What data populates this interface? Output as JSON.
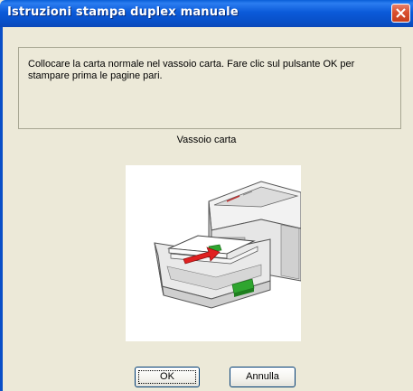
{
  "window": {
    "title": "Istruzioni stampa duplex manuale"
  },
  "message": {
    "text": "Collocare la carta normale nel vassoio carta.  Fare clic sul pulsante OK per stampare prima le pagine pari."
  },
  "tray": {
    "label": "Vassoio carta"
  },
  "buttons": {
    "ok_label": "OK",
    "cancel_label": "Annulla"
  },
  "icons": {
    "close": "close-icon",
    "illustration": "printer-tray-illustration"
  },
  "colors": {
    "titlebar": "#0b5ad9",
    "close_button": "#d9502f",
    "dialog_background": "#ece9d8",
    "arrow": "#e02020",
    "guide": "#2fa52f"
  }
}
